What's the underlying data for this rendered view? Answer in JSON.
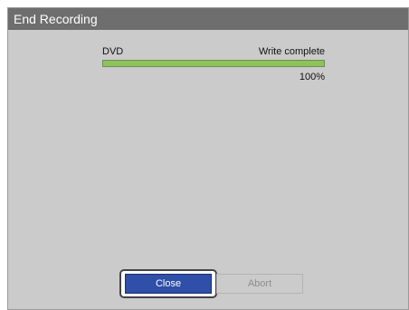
{
  "dialog": {
    "title": "End Recording"
  },
  "progress": {
    "device": "DVD",
    "status": "Write complete",
    "percent_label": "100%",
    "fraction": 1.0
  },
  "buttons": {
    "close_label": "Close",
    "abort_label": "Abort"
  },
  "colors": {
    "titlebar": "#6e6e6e",
    "progress_fill": "#8cc35a",
    "primary_button": "#2f4fa8",
    "dialog_background": "#cbcbcb"
  }
}
